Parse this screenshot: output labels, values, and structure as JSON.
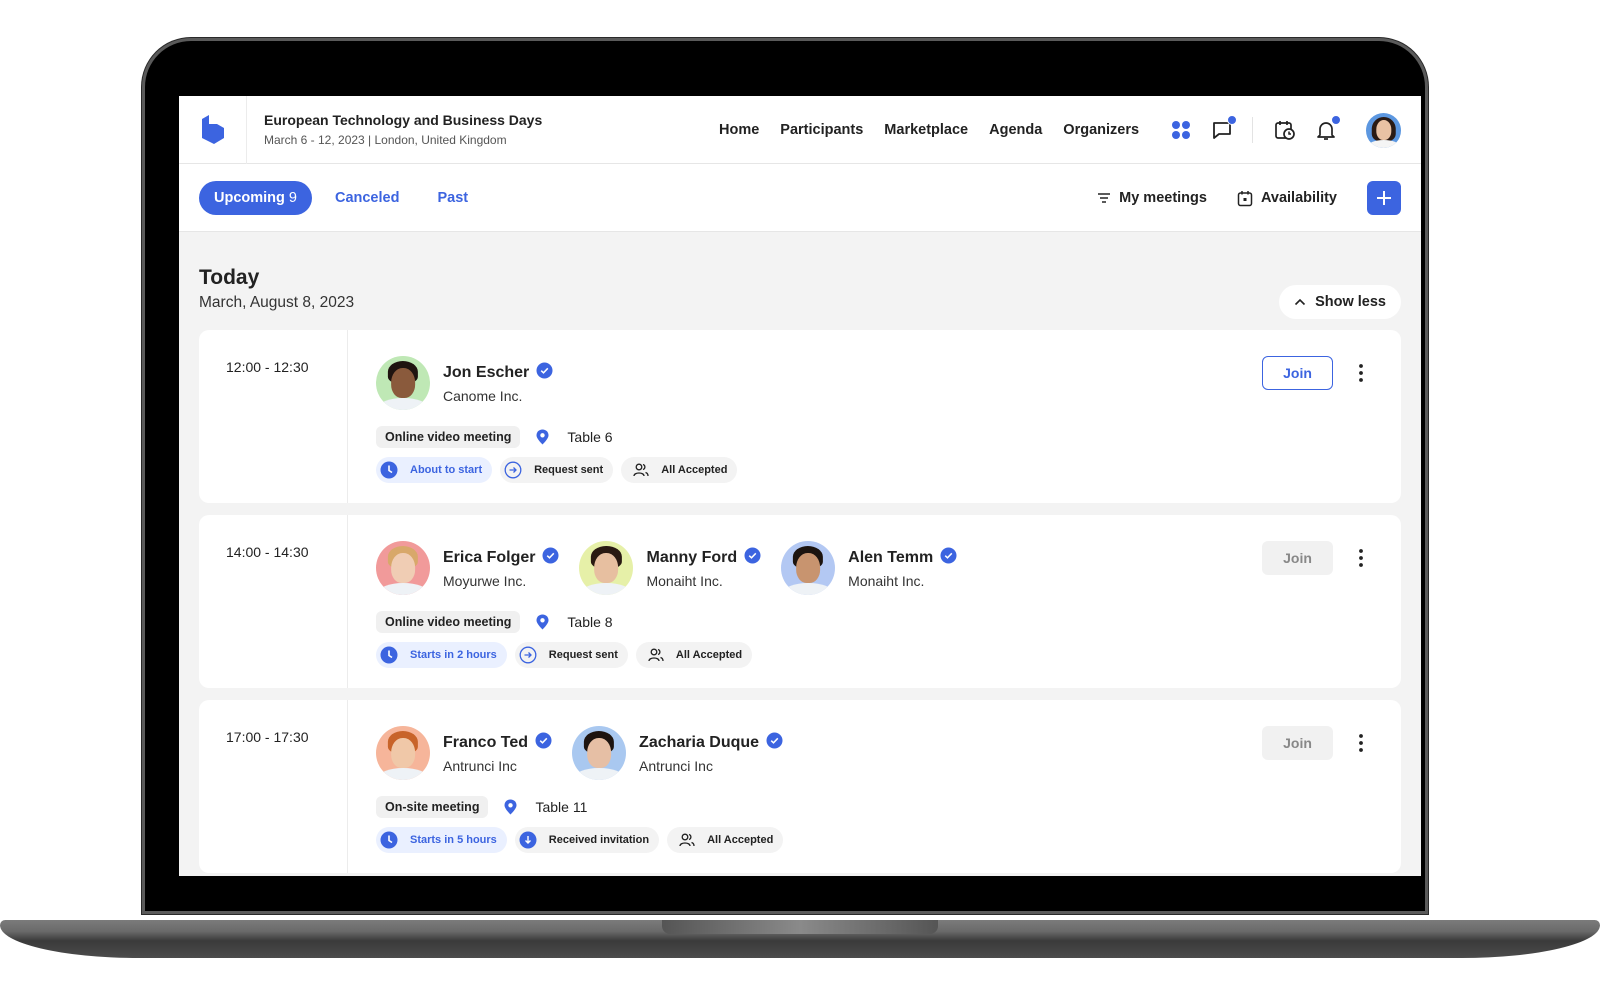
{
  "header": {
    "event_title": "European Technology and Business Days",
    "event_subtitle": "March 6 - 12, 2023 | London, United Kingdom",
    "nav": [
      "Home",
      "Participants",
      "Marketplace",
      "Agenda",
      "Organizers"
    ],
    "icons": [
      "apps-grid-icon",
      "chat-icon",
      "calendar-clock-icon",
      "bell-icon",
      "user-avatar"
    ],
    "brand_color": "#3c64e0"
  },
  "tabs": {
    "items": [
      {
        "label": "Upcoming",
        "count": "9",
        "active": true
      },
      {
        "label": "Canceled",
        "count": "",
        "active": false
      },
      {
        "label": "Past",
        "count": "",
        "active": false
      }
    ],
    "my_meetings": "My meetings",
    "availability": "Availability"
  },
  "section": {
    "title": "Today",
    "date": "March, August 8, 2023",
    "toggle": "Show less"
  },
  "meetings": [
    {
      "time": "12:00 - 12:30",
      "people": [
        {
          "name": "Jon Escher",
          "company": "Canome Inc.",
          "bg": "#bfe8b5"
        }
      ],
      "type": "Online video meeting",
      "location": "Table 6",
      "status": [
        {
          "label": "About to start",
          "icon": "clock-icon",
          "style": "blue"
        },
        {
          "label": "Request sent",
          "icon": "arrow-right-circle-icon",
          "style": "gray"
        },
        {
          "label": "All Accepted",
          "icon": "users-icon",
          "style": "gray"
        }
      ],
      "join": "Join",
      "join_enabled": true
    },
    {
      "time": "14:00 - 14:30",
      "people": [
        {
          "name": "Erica Folger",
          "company": "Moyurwe Inc.",
          "bg": "#f19a9a"
        },
        {
          "name": "Manny Ford",
          "company": "Monaiht Inc.",
          "bg": "#e6f0a8"
        },
        {
          "name": "Alen Temm",
          "company": "Monaiht Inc.",
          "bg": "#b3c8f3"
        }
      ],
      "type": "Online video meeting",
      "location": "Table 8",
      "status": [
        {
          "label": "Starts in 2 hours",
          "icon": "clock-icon",
          "style": "blue"
        },
        {
          "label": "Request sent",
          "icon": "arrow-right-circle-icon",
          "style": "gray"
        },
        {
          "label": "All Accepted",
          "icon": "users-icon",
          "style": "gray"
        }
      ],
      "join": "Join",
      "join_enabled": false
    },
    {
      "time": "17:00 - 17:30",
      "people": [
        {
          "name": "Franco Ted",
          "company": "Antrunci Inc",
          "bg": "#f6b59a"
        },
        {
          "name": "Zacharia Duque",
          "company": "Antrunci Inc",
          "bg": "#a9c8f0"
        }
      ],
      "type": "On-site meeting",
      "location": "Table 11",
      "status": [
        {
          "label": "Starts in 5 hours",
          "icon": "clock-icon",
          "style": "blue"
        },
        {
          "label": "Received invitation",
          "icon": "arrow-down-circle-icon",
          "style": "gray"
        },
        {
          "label": "All Accepted",
          "icon": "users-icon",
          "style": "gray"
        }
      ],
      "join": "Join",
      "join_enabled": false
    }
  ]
}
